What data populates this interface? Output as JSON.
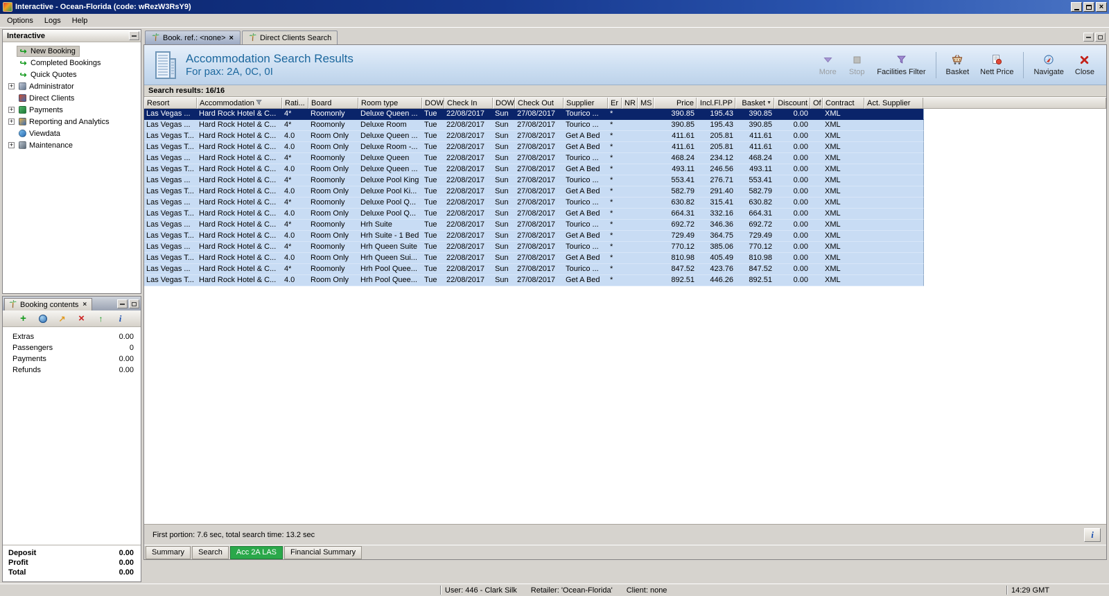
{
  "window": {
    "title": "Interactive - Ocean-Florida (code: wRezW3RsY9)",
    "menu": [
      "Options",
      "Logs",
      "Help"
    ]
  },
  "sidebar": {
    "title": "Interactive",
    "items": [
      {
        "label": "New Booking",
        "icon": "booking-arrow-icon",
        "selected": true
      },
      {
        "label": "Completed Bookings",
        "icon": "booking-arrow-icon"
      },
      {
        "label": "Quick Quotes",
        "icon": "booking-arrow-icon"
      },
      {
        "label": "Administrator",
        "icon": "administrator-icon",
        "expandable": true
      },
      {
        "label": "Direct Clients",
        "icon": "direct-clients-icon"
      },
      {
        "label": "Payments",
        "icon": "payments-icon",
        "expandable": true
      },
      {
        "label": "Reporting and Analytics",
        "icon": "reporting-icon",
        "expandable": true
      },
      {
        "label": "Viewdata",
        "icon": "viewdata-icon"
      },
      {
        "label": "Maintenance",
        "icon": "maintenance-icon",
        "expandable": true
      }
    ]
  },
  "booking_contents": {
    "title": "Booking contents",
    "toolbar": [
      "add-icon",
      "world-icon",
      "transfer-icon",
      "delete-icon",
      "promote-icon",
      "info-icon"
    ],
    "rows": [
      {
        "label": "Extras",
        "value": "0.00"
      },
      {
        "label": "Passengers",
        "value": "0"
      },
      {
        "label": "Payments",
        "value": "0.00"
      },
      {
        "label": "Refunds",
        "value": "0.00"
      }
    ],
    "summary": [
      {
        "label": "Deposit",
        "value": "0.00"
      },
      {
        "label": "Profit",
        "value": "0.00"
      },
      {
        "label": "Total",
        "value": "0.00"
      }
    ]
  },
  "main": {
    "tabs": [
      {
        "label": "Book. ref.: <none>",
        "active": true,
        "closable": true
      },
      {
        "label": "Direct Clients Search"
      }
    ],
    "header": {
      "title": "Accommodation Search Results",
      "subtitle": "For pax: 2A, 0C, 0I"
    },
    "toolbar": [
      {
        "label": "More",
        "icon": "more-icon",
        "disabled": true
      },
      {
        "label": "Stop",
        "icon": "stop-icon",
        "disabled": true
      },
      {
        "label": "Facilities Filter",
        "icon": "facilities-filter-icon"
      },
      {
        "label": "Basket",
        "icon": "basket-icon",
        "group_start": true
      },
      {
        "label": "Nett Price",
        "icon": "nett-price-icon"
      },
      {
        "label": "Navigate",
        "icon": "navigate-icon",
        "group_start": true
      },
      {
        "label": "Close",
        "icon": "close-icon"
      }
    ],
    "results_label": "Search results: 16/16",
    "table": {
      "selected_row": 0,
      "columns": [
        {
          "label": "Resort"
        },
        {
          "label": "Accommodation",
          "filter": true
        },
        {
          "label": "Rati..."
        },
        {
          "label": "Board"
        },
        {
          "label": "Room type"
        },
        {
          "label": "DOW"
        },
        {
          "label": "Check In"
        },
        {
          "label": "DOW"
        },
        {
          "label": "Check Out"
        },
        {
          "label": "Supplier"
        },
        {
          "label": "Er"
        },
        {
          "label": "NR"
        },
        {
          "label": "MS"
        },
        {
          "label": "Price",
          "align": "right"
        },
        {
          "label": "Incl.Fl.PP",
          "align": "right"
        },
        {
          "label": "Basket",
          "align": "right",
          "sort": "desc"
        },
        {
          "label": "Discount",
          "align": "right"
        },
        {
          "label": "Of"
        },
        {
          "label": "Contract"
        },
        {
          "label": "Act. Supplier"
        }
      ],
      "rows": [
        [
          "Las Vegas ...",
          "Hard Rock Hotel & C...",
          "4*",
          "Roomonly",
          "Deluxe Queen ...",
          "Tue",
          "22/08/2017",
          "Sun",
          "27/08/2017",
          "Tourico ...",
          "*",
          "",
          "",
          "390.85",
          "195.43",
          "390.85",
          "0.00",
          "",
          "XML",
          ""
        ],
        [
          "Las Vegas ...",
          "Hard Rock Hotel & C...",
          "4*",
          "Roomonly",
          "Deluxe Room",
          "Tue",
          "22/08/2017",
          "Sun",
          "27/08/2017",
          "Tourico ...",
          "*",
          "",
          "",
          "390.85",
          "195.43",
          "390.85",
          "0.00",
          "",
          "XML",
          ""
        ],
        [
          "Las Vegas T...",
          "Hard Rock Hotel & C...",
          "4.0",
          "Room Only",
          "Deluxe Queen ...",
          "Tue",
          "22/08/2017",
          "Sun",
          "27/08/2017",
          "Get A Bed",
          "*",
          "",
          "",
          "411.61",
          "205.81",
          "411.61",
          "0.00",
          "",
          "XML",
          ""
        ],
        [
          "Las Vegas T...",
          "Hard Rock Hotel & C...",
          "4.0",
          "Room Only",
          "Deluxe Room -...",
          "Tue",
          "22/08/2017",
          "Sun",
          "27/08/2017",
          "Get A Bed",
          "*",
          "",
          "",
          "411.61",
          "205.81",
          "411.61",
          "0.00",
          "",
          "XML",
          ""
        ],
        [
          "Las Vegas ...",
          "Hard Rock Hotel & C...",
          "4*",
          "Roomonly",
          "Deluxe Queen",
          "Tue",
          "22/08/2017",
          "Sun",
          "27/08/2017",
          "Tourico ...",
          "*",
          "",
          "",
          "468.24",
          "234.12",
          "468.24",
          "0.00",
          "",
          "XML",
          ""
        ],
        [
          "Las Vegas T...",
          "Hard Rock Hotel & C...",
          "4.0",
          "Room Only",
          "Deluxe Queen ...",
          "Tue",
          "22/08/2017",
          "Sun",
          "27/08/2017",
          "Get A Bed",
          "*",
          "",
          "",
          "493.11",
          "246.56",
          "493.11",
          "0.00",
          "",
          "XML",
          ""
        ],
        [
          "Las Vegas ...",
          "Hard Rock Hotel & C...",
          "4*",
          "Roomonly",
          "Deluxe Pool King",
          "Tue",
          "22/08/2017",
          "Sun",
          "27/08/2017",
          "Tourico ...",
          "*",
          "",
          "",
          "553.41",
          "276.71",
          "553.41",
          "0.00",
          "",
          "XML",
          ""
        ],
        [
          "Las Vegas T...",
          "Hard Rock Hotel & C...",
          "4.0",
          "Room Only",
          "Deluxe Pool Ki...",
          "Tue",
          "22/08/2017",
          "Sun",
          "27/08/2017",
          "Get A Bed",
          "*",
          "",
          "",
          "582.79",
          "291.40",
          "582.79",
          "0.00",
          "",
          "XML",
          ""
        ],
        [
          "Las Vegas ...",
          "Hard Rock Hotel & C...",
          "4*",
          "Roomonly",
          "Deluxe Pool Q...",
          "Tue",
          "22/08/2017",
          "Sun",
          "27/08/2017",
          "Tourico ...",
          "*",
          "",
          "",
          "630.82",
          "315.41",
          "630.82",
          "0.00",
          "",
          "XML",
          ""
        ],
        [
          "Las Vegas T...",
          "Hard Rock Hotel & C...",
          "4.0",
          "Room Only",
          "Deluxe Pool Q...",
          "Tue",
          "22/08/2017",
          "Sun",
          "27/08/2017",
          "Get A Bed",
          "*",
          "",
          "",
          "664.31",
          "332.16",
          "664.31",
          "0.00",
          "",
          "XML",
          ""
        ],
        [
          "Las Vegas ...",
          "Hard Rock Hotel & C...",
          "4*",
          "Roomonly",
          "Hrh Suite",
          "Tue",
          "22/08/2017",
          "Sun",
          "27/08/2017",
          "Tourico ...",
          "*",
          "",
          "",
          "692.72",
          "346.36",
          "692.72",
          "0.00",
          "",
          "XML",
          ""
        ],
        [
          "Las Vegas T...",
          "Hard Rock Hotel & C...",
          "4.0",
          "Room Only",
          "Hrh Suite - 1 Bed",
          "Tue",
          "22/08/2017",
          "Sun",
          "27/08/2017",
          "Get A Bed",
          "*",
          "",
          "",
          "729.49",
          "364.75",
          "729.49",
          "0.00",
          "",
          "XML",
          ""
        ],
        [
          "Las Vegas ...",
          "Hard Rock Hotel & C...",
          "4*",
          "Roomonly",
          "Hrh Queen Suite",
          "Tue",
          "22/08/2017",
          "Sun",
          "27/08/2017",
          "Tourico ...",
          "*",
          "",
          "",
          "770.12",
          "385.06",
          "770.12",
          "0.00",
          "",
          "XML",
          ""
        ],
        [
          "Las Vegas T...",
          "Hard Rock Hotel & C...",
          "4.0",
          "Room Only",
          "Hrh Queen Sui...",
          "Tue",
          "22/08/2017",
          "Sun",
          "27/08/2017",
          "Get A Bed",
          "*",
          "",
          "",
          "810.98",
          "405.49",
          "810.98",
          "0.00",
          "",
          "XML",
          ""
        ],
        [
          "Las Vegas ...",
          "Hard Rock Hotel & C...",
          "4*",
          "Roomonly",
          "Hrh Pool Quee...",
          "Tue",
          "22/08/2017",
          "Sun",
          "27/08/2017",
          "Tourico ...",
          "*",
          "",
          "",
          "847.52",
          "423.76",
          "847.52",
          "0.00",
          "",
          "XML",
          ""
        ],
        [
          "Las Vegas T...",
          "Hard Rock Hotel & C...",
          "4.0",
          "Room Only",
          "Hrh Pool Quee...",
          "Tue",
          "22/08/2017",
          "Sun",
          "27/08/2017",
          "Get A Bed",
          "*",
          "",
          "",
          "892.51",
          "446.26",
          "892.51",
          "0.00",
          "",
          "XML",
          ""
        ]
      ]
    },
    "status_text": "First portion: 7.6 sec, total search time: 13.2 sec",
    "bottom_tabs": [
      {
        "label": "Summary"
      },
      {
        "label": "Search"
      },
      {
        "label": "Acc 2A LAS",
        "active": true
      },
      {
        "label": "Financial Summary"
      }
    ]
  },
  "statusbar": {
    "user": "User: 446 - Clark Silk",
    "retailer": "Retailer: 'Ocean-Florida'",
    "client": "Client: none",
    "time": "14:29 GMT"
  },
  "colors": {
    "selection_blue": "#0a246a",
    "row_blue": "#c8dcf4",
    "active_view_tab_green": "#2aa84a",
    "header_title_blue": "#1d689e"
  }
}
